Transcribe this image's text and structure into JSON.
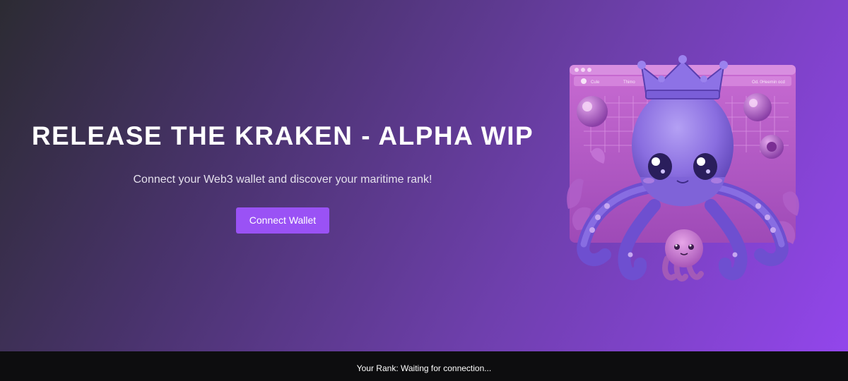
{
  "hero": {
    "title": "RELEASE THE KRAKEN - ALPHA WIP",
    "subtitle": "Connect your Web3 wallet and discover your maritime rank!",
    "connect_button_label": "Connect Wallet",
    "image": {
      "icon": "kraken-mascot-illustration",
      "window_tab_left": "Cule",
      "window_tab_middle": "Thimo",
      "window_tab_right": "Od. 0Heemin ocd"
    }
  },
  "status": {
    "rank_text": "Your Rank: Waiting for connection..."
  },
  "colors": {
    "accent": "#9a52f5",
    "status_bar": "#0d0d0f",
    "gradient_start": "#2c2b33",
    "gradient_end": "#9446ee"
  }
}
